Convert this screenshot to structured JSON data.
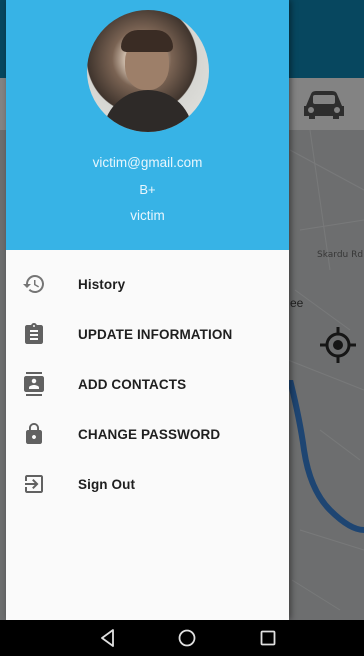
{
  "background": {
    "road_label": "Skardu Rd",
    "partial_text": "ee"
  },
  "drawer": {
    "header": {
      "email": "victim@gmail.com",
      "blood_group": "B+",
      "name": "victim",
      "accent": "#37b3e6"
    },
    "menu": [
      {
        "label": "History",
        "icon": "history-icon"
      },
      {
        "label": "UPDATE INFORMATION",
        "icon": "clipboard-icon"
      },
      {
        "label": "ADD CONTACTS",
        "icon": "contact-card-icon"
      },
      {
        "label": "CHANGE PASSWORD",
        "icon": "lock-icon"
      },
      {
        "label": "Sign Out",
        "icon": "sign-out-icon"
      }
    ]
  },
  "navbar": {
    "buttons": [
      "back-icon",
      "home-icon",
      "recents-icon"
    ]
  }
}
